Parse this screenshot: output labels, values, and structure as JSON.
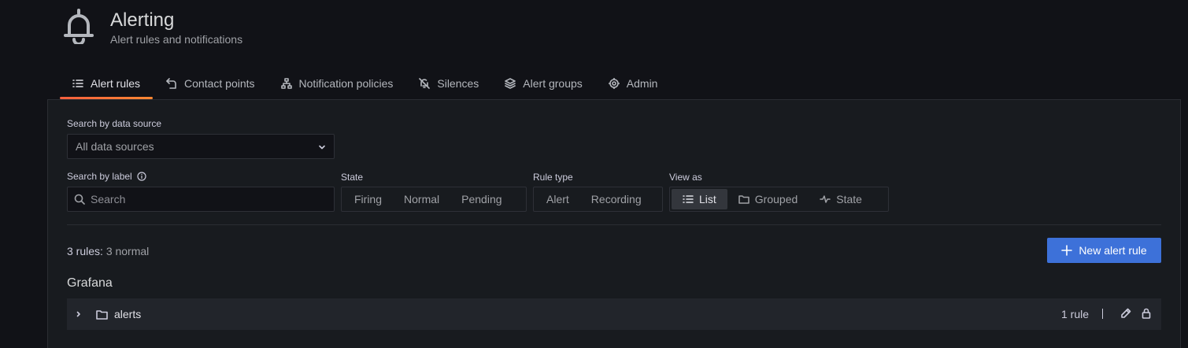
{
  "header": {
    "title": "Alerting",
    "subtitle": "Alert rules and notifications",
    "icon": "bell-icon"
  },
  "tabs": [
    {
      "label": "Alert rules",
      "icon": "list-icon",
      "active": true
    },
    {
      "label": "Contact points",
      "icon": "comment-alt-share-icon",
      "active": false
    },
    {
      "label": "Notification policies",
      "icon": "sitemap-icon",
      "active": false
    },
    {
      "label": "Silences",
      "icon": "bell-slash-icon",
      "active": false
    },
    {
      "label": "Alert groups",
      "icon": "layer-group-icon",
      "active": false
    },
    {
      "label": "Admin",
      "icon": "cog-icon",
      "active": false
    }
  ],
  "filters": {
    "datasource": {
      "label": "Search by data source",
      "value": "All data sources"
    },
    "label_search": {
      "label": "Search by label",
      "placeholder": "Search"
    },
    "state": {
      "label": "State",
      "options": [
        "Firing",
        "Normal",
        "Pending"
      ]
    },
    "rule_type": {
      "label": "Rule type",
      "options": [
        "Alert",
        "Recording"
      ]
    },
    "view_as": {
      "label": "View as",
      "options": [
        "List",
        "Grouped",
        "State"
      ],
      "selected": "List"
    }
  },
  "summary": {
    "count": "3 rules:",
    "detail": "3 normal"
  },
  "new_button": {
    "label": "New alert rule"
  },
  "section": {
    "title": "Grafana"
  },
  "rule_group": {
    "name": "alerts",
    "count": "1 rule"
  },
  "colors": {
    "accent": "#3d71d9",
    "tab_underline": "#f55f3e",
    "background": "#111217",
    "panel": "#181b1f"
  }
}
